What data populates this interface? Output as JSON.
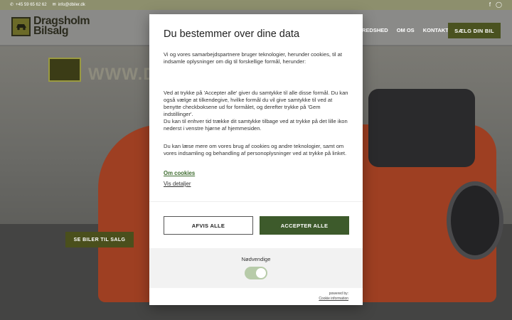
{
  "topbar": {
    "phone": "+45 59 65 62 62",
    "email": "info@dbiler.dk",
    "social": [
      "facebook-icon",
      "instagram-icon"
    ]
  },
  "header": {
    "logo_line1": "Dragsholm",
    "logo_line2": "Bilsalg",
    "nav": [
      "REDSHED",
      "OM OS",
      "KONTAKT"
    ],
    "cta": "SÆLG DIN BIL"
  },
  "hero": {
    "sign_text": "WWW.D",
    "cta": "SE BILER TIL SALG"
  },
  "modal": {
    "title": "Du bestemmer over dine data",
    "intro": "Vi og vores samarbejdspartnere bruger teknologier, herunder cookies, til at indsamle oplysninger om dig til forskellige formål, herunder:",
    "consent_text": "Ved at trykke på 'Accepter alle' giver du samtykke til alle disse formål. Du kan også vælge at tilkendegive, hvilke formål du vil give samtykke til ved at benytte checkboksene ud for formålet, og derefter trykke på 'Gem indstillinger'.",
    "withdraw_text": "Du kan til enhver tid trække dit samtykke tilbage ved at trykke på det lille ikon nederst i venstre hjørne af hjemmesiden.",
    "more_text": "Du kan læse mere om vores brug af cookies og andre teknologier, samt om vores indsamling og behandling af personoplysninger ved at trykke på linket.",
    "link_cookies": "Om cookies",
    "link_details": "Vis detaljer",
    "reject_label": "AFVIS ALLE",
    "accept_label": "ACCEPTER ALLE",
    "necessary_label": "Nødvendige",
    "necessary_enabled": true,
    "powered_by": "powered by:",
    "powered_link": "Cookie information"
  },
  "colors": {
    "accent": "#3d5a2b",
    "brand_olive": "#4a5220",
    "toggle_on": "#b7cba9"
  }
}
